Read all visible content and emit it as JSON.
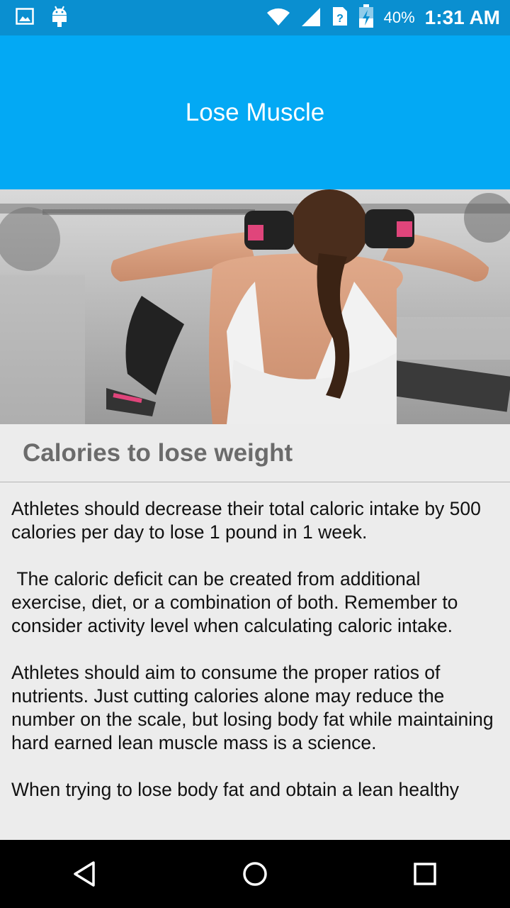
{
  "status_bar": {
    "battery_percent": "40%",
    "time": "1:31 AM",
    "icons": [
      "image-icon",
      "android-icon",
      "wifi-icon",
      "signal-icon",
      "sim-unknown-icon",
      "battery-charging-icon"
    ]
  },
  "app_bar": {
    "title": "Lose Muscle",
    "color": "#03a9f4"
  },
  "hero_image": {
    "description_icon": "workout-photo"
  },
  "section": {
    "title": "Calories to lose weight"
  },
  "body": {
    "paragraphs": [
      "Athletes should decrease their total caloric intake by 500 calories per day to lose 1 pound in 1 week.",
      " The caloric deficit can be created from additional exercise, diet, or a combination of both. Remember to consider activity level when calculating caloric intake.",
      "Athletes should aim to consume the proper ratios of nutrients. Just cutting calories alone may reduce the number on the scale, but losing body fat while maintaining hard earned lean muscle mass is a science.",
      "When trying to lose body fat and obtain a lean healthy"
    ]
  },
  "nav_bar": {
    "buttons": [
      "back-icon",
      "home-icon",
      "recents-icon"
    ]
  }
}
